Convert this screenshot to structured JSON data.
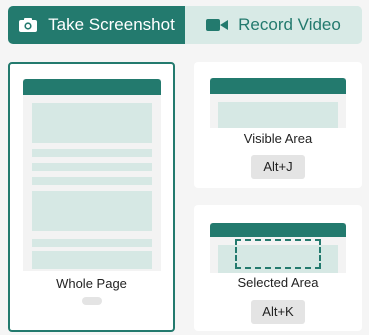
{
  "tabs": {
    "screenshot": {
      "label": "Take Screenshot",
      "icon": "camera-icon",
      "active": true
    },
    "video": {
      "label": "Record Video",
      "icon": "video-camera-icon",
      "active": false
    }
  },
  "options": {
    "whole_page": {
      "label": "Whole Page",
      "shortcut": "",
      "selected": true
    },
    "visible_area": {
      "label": "Visible Area",
      "shortcut": "Alt+J"
    },
    "selected_area": {
      "label": "Selected Area",
      "shortcut": "Alt+K"
    }
  },
  "colors": {
    "accent": "#237a6e",
    "accent_light": "#d8eae6",
    "preview_block": "#d6e8e4",
    "background": "#f5f5f5"
  }
}
